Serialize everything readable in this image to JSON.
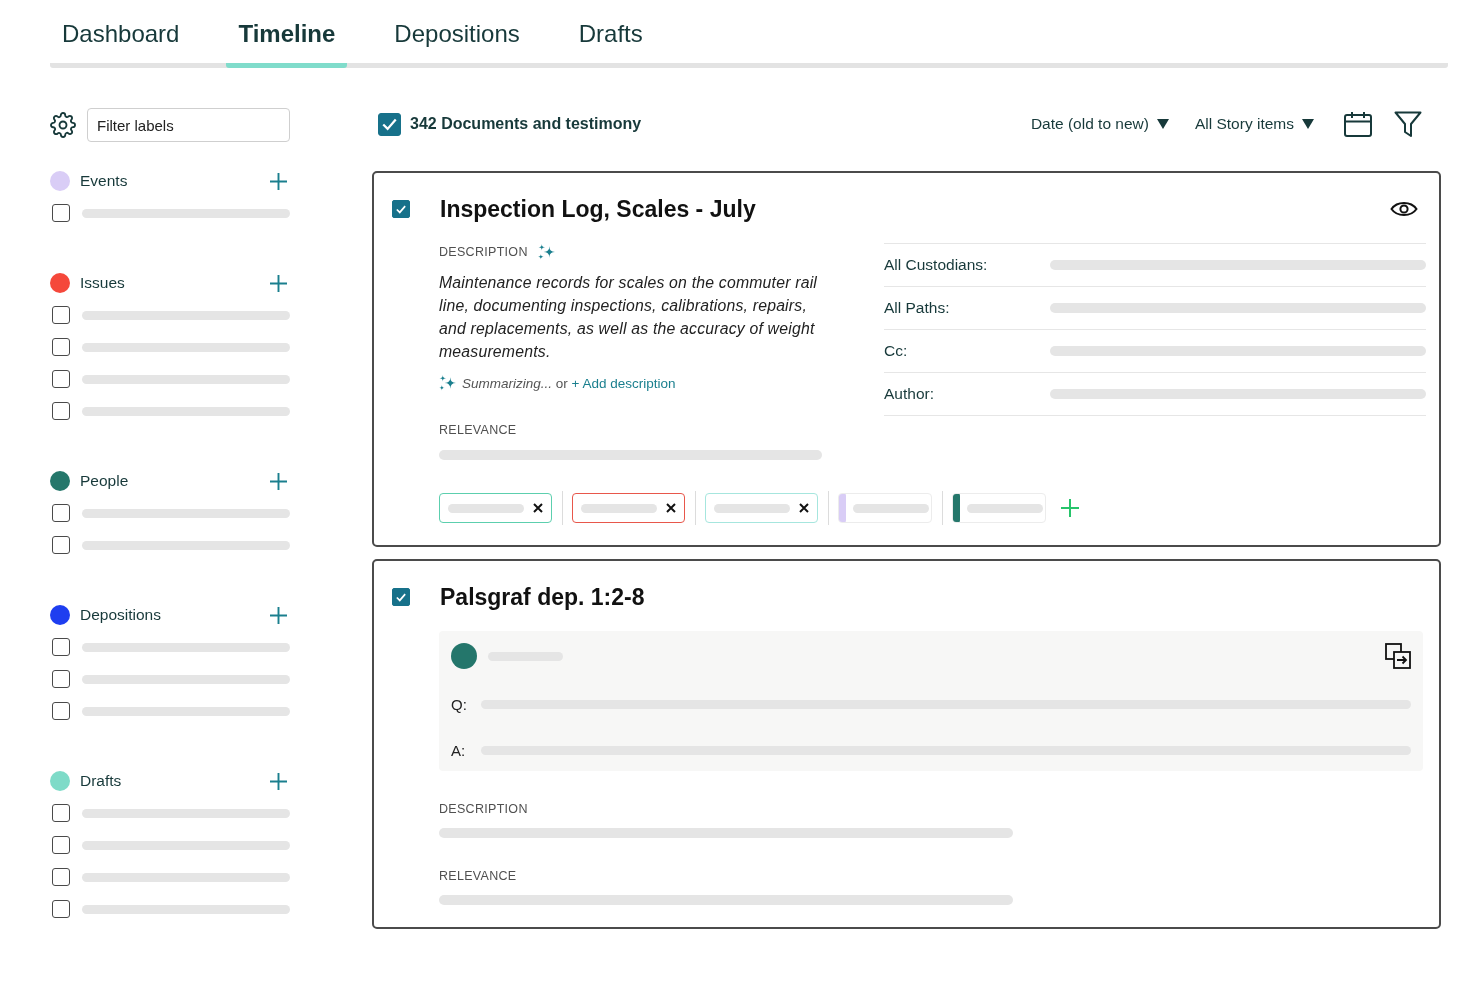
{
  "tabs": [
    {
      "label": "Dashboard",
      "selected": false
    },
    {
      "label": "Timeline",
      "selected": true
    },
    {
      "label": "Depositions",
      "selected": false
    },
    {
      "label": "Drafts",
      "selected": false
    }
  ],
  "sidebar": {
    "filter": {
      "placeholder": "Filter labels"
    },
    "groups": [
      {
        "label": "Events",
        "color": "#d9cdf6",
        "items": [
          {
            "checked": false
          }
        ]
      },
      {
        "label": "Issues",
        "color": "#f5483b",
        "items": [
          {
            "checked": false
          },
          {
            "checked": false
          },
          {
            "checked": false
          },
          {
            "checked": false
          }
        ]
      },
      {
        "label": "People",
        "color": "#25776b",
        "items": [
          {
            "checked": false
          },
          {
            "checked": false
          }
        ]
      },
      {
        "label": "Depositions",
        "color": "#1e3ef0",
        "items": [
          {
            "checked": false
          },
          {
            "checked": false
          },
          {
            "checked": false
          }
        ]
      },
      {
        "label": "Drafts",
        "color": "#7edbc8",
        "items": [
          {
            "checked": false
          },
          {
            "checked": false
          },
          {
            "checked": false
          },
          {
            "checked": false
          }
        ]
      }
    ]
  },
  "toolbar": {
    "select_all": {
      "label": "342 Documents and testimony",
      "checked": true
    },
    "sort": "Date (old to new)",
    "item_filter": "All Story items"
  },
  "cards": [
    {
      "kind": "document",
      "checked": true,
      "title": "Inspection Log, Scales - July",
      "description_label": "DESCRIPTION",
      "description": "Maintenance records for scales on the commuter rail line, documenting inspections, calibrations, repairs, and replacements, as well as the accuracy of weight measurements.",
      "summary_status": "*Summarizing...* or",
      "add_description": "+ Add description",
      "relevance_label": "RELEVANCE",
      "fields": [
        {
          "label": "All Custodians:"
        },
        {
          "label": "All Paths:"
        },
        {
          "label": "Cc:"
        },
        {
          "label": "Author:"
        }
      ],
      "tags": [
        {
          "kind": "outline",
          "color": "#5ccfae"
        },
        {
          "kind": "outline",
          "color": "#e8574b"
        },
        {
          "kind": "outline",
          "color": "#a6e6de"
        },
        {
          "kind": "bar",
          "color": "#d9cdf6"
        },
        {
          "kind": "bar",
          "color": "#25776b"
        }
      ]
    },
    {
      "kind": "deposition",
      "checked": true,
      "title": "Palsgraf dep. 1:2-8",
      "testimony": {
        "question_label": "Q:",
        "answer_label": "A:"
      },
      "description_label": "DESCRIPTION",
      "relevance_label": "RELEVANCE"
    }
  ]
}
